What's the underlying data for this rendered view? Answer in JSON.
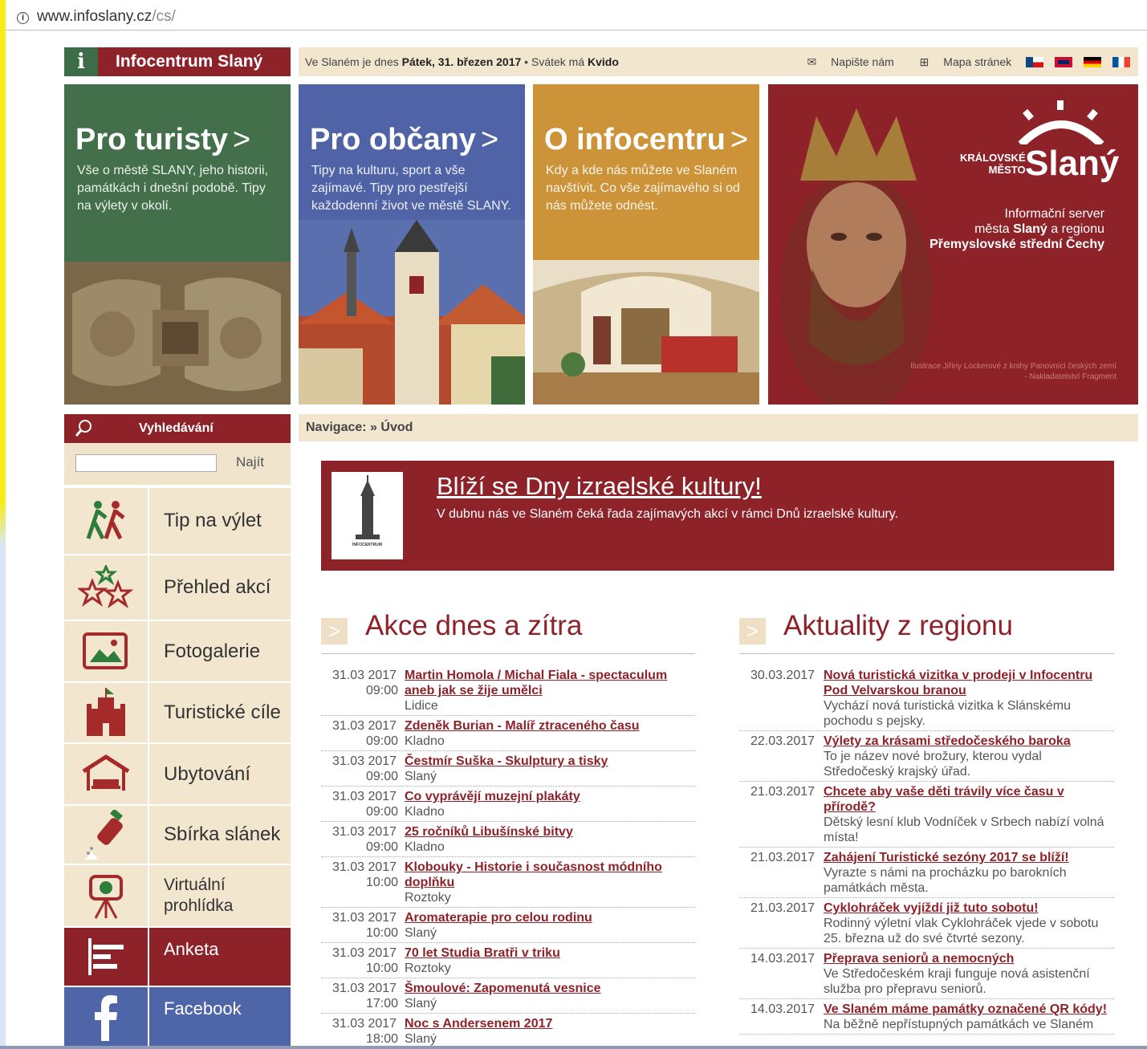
{
  "browser": {
    "url_host": "www.infoslany.cz",
    "url_path": "/cs/"
  },
  "logo": {
    "title": "Infocentrum Slaný"
  },
  "topbar": {
    "prefix": "Ve Slaném je dnes",
    "date": "Pátek, 31. březen 2017",
    "sep": " • Svátek má ",
    "name": "Kvido",
    "contact": "Napište nám",
    "sitemap": "Mapa stránek"
  },
  "tiles": [
    {
      "title": "Pro turisty",
      "text": "Vše o městě SLANY, jeho historii, památkách i dnešní podobě. Tipy na výlety v okolí."
    },
    {
      "title": "Pro občany",
      "text": "Tipy na kulturu, sport a vše zajímavé. Tipy pro pestřejší každodenní život ve městě SLANY."
    },
    {
      "title": "O infocentru",
      "text": "Kdy a kde nás můžete ve Slaném navštívit. Co vše zajímavého si od nás můžete odnést."
    }
  ],
  "brand": {
    "royal": "KRÁLOVSKÉ",
    "mesto": "MĚSTO",
    "name": "Slaný",
    "server1": "Informační server",
    "server2a": "města ",
    "server2b": "Slaný",
    "server2c": " a regionu",
    "server3": "Přemyslovské střední Čechy",
    "credit1": "Ilustrace Jiřiny Lockerové z knihy Panovníci českých zemí",
    "credit2": "- Nakladatelství Fragment"
  },
  "search": {
    "heading": "Vyhledávání",
    "button": "Najít"
  },
  "menu": [
    {
      "label": "Tip na výlet"
    },
    {
      "label": "Přehled akcí"
    },
    {
      "label": "Fotogalerie"
    },
    {
      "label": "Turistické cíle"
    },
    {
      "label": "Ubytování"
    },
    {
      "label": "Sbírka slánek"
    },
    {
      "label": "Virtuální prohlídka"
    },
    {
      "label": "Anketa"
    },
    {
      "label": "Facebook"
    }
  ],
  "nav": {
    "label": "Navigace:",
    "sep": " » ",
    "current": "Úvod"
  },
  "banner": {
    "title": "Blíží se Dny izraelské kultury!",
    "text": "V dubnu nás ve Slaném čeká řada zajímavých akcí v rámci Dnů izraelské kultury.",
    "thumb_caption": "INFOCENTRUM"
  },
  "events": {
    "heading": "Akce dnes a zítra",
    "items": [
      {
        "date": "31.03 2017",
        "title": "Martin Homola / Michal Fiala - spectaculum",
        "time": "09:00",
        "title2": "aneb jak se žije umělci",
        "place": "Lidice"
      },
      {
        "date": "31.03 2017",
        "title": "Zdeněk Burian - Malíř ztraceného času",
        "time": "09:00",
        "place": "Kladno"
      },
      {
        "date": "31.03 2017",
        "title": "Čestmír Suška - Skulptury a tisky",
        "time": "09:00",
        "place": "Slaný"
      },
      {
        "date": "31.03 2017",
        "title": "Co vyprávějí muzejní plakáty",
        "time": "09:00",
        "place": "Kladno"
      },
      {
        "date": "31.03 2017",
        "title": "25 ročníků Libušínské bitvy",
        "time": "09:00",
        "place": "Kladno"
      },
      {
        "date": "31.03 2017",
        "title": "Klobouky - Historie i současnost módního",
        "time": "10:00",
        "title2": "doplňku",
        "place": "Roztoky"
      },
      {
        "date": "31.03 2017",
        "title": "Aromaterapie pro celou rodinu",
        "time": "10:00",
        "place": "Slaný"
      },
      {
        "date": "31.03 2017",
        "title": "70 let Studia Bratři v triku",
        "time": "10:00",
        "place": "Roztoky"
      },
      {
        "date": "31.03 2017",
        "title": "Šmoulové: Zapomenutá vesnice",
        "time": "17:00",
        "place": "Slaný"
      },
      {
        "date": "31.03 2017",
        "title": "Noc s Andersenem 2017",
        "time": "18:00",
        "place": "Slaný"
      }
    ]
  },
  "news": {
    "heading": "Aktuality z regionu",
    "items": [
      {
        "date": "30.03.2017",
        "title": "Nová turistická vizitka v prodeji v Infocentru Pod Velvarskou branou",
        "text": "Vychází nová turistická vizitka k Slánskému pochodu s pejsky."
      },
      {
        "date": "22.03.2017",
        "title": "Výlety za krásami středočeského baroka",
        "text": "To je název nové brožury, kterou vydal Středočeský krajský úřad."
      },
      {
        "date": "21.03.2017",
        "title": "Chcete aby vaše děti trávily více času v přírodě?",
        "text": "Dětský lesní klub Vodníček v Srbech nabízí volná místa!"
      },
      {
        "date": "21.03.2017",
        "title": "Zahájení Turistické sezóny 2017 se blíží!",
        "text": "Vyrazte s námi na procházku po barokních památkách města."
      },
      {
        "date": "21.03.2017",
        "title": "Cyklohráček vyjíždí již tuto sobotu!",
        "text": "Rodinný výletní vlak Cyklohráček vjede v sobotu 25. března už do své čtvrté sezony."
      },
      {
        "date": "14.03.2017",
        "title": "Přeprava seniorů a nemocných",
        "text": "Ve Středočeském kraji funguje nová asistenční služba pro přepravu seniorů."
      },
      {
        "date": "14.03.2017",
        "title": "Ve Slaném máme památky označené QR kódy!",
        "text": "Na běžně nepřístupných památkách ve Slaném"
      }
    ]
  },
  "colors": {
    "maroon": "#8e2229",
    "green": "#43704a",
    "blue": "#4f63a6",
    "orange": "#cd9339",
    "beige": "#f3e6cf",
    "facebook": "#4e66a8"
  }
}
